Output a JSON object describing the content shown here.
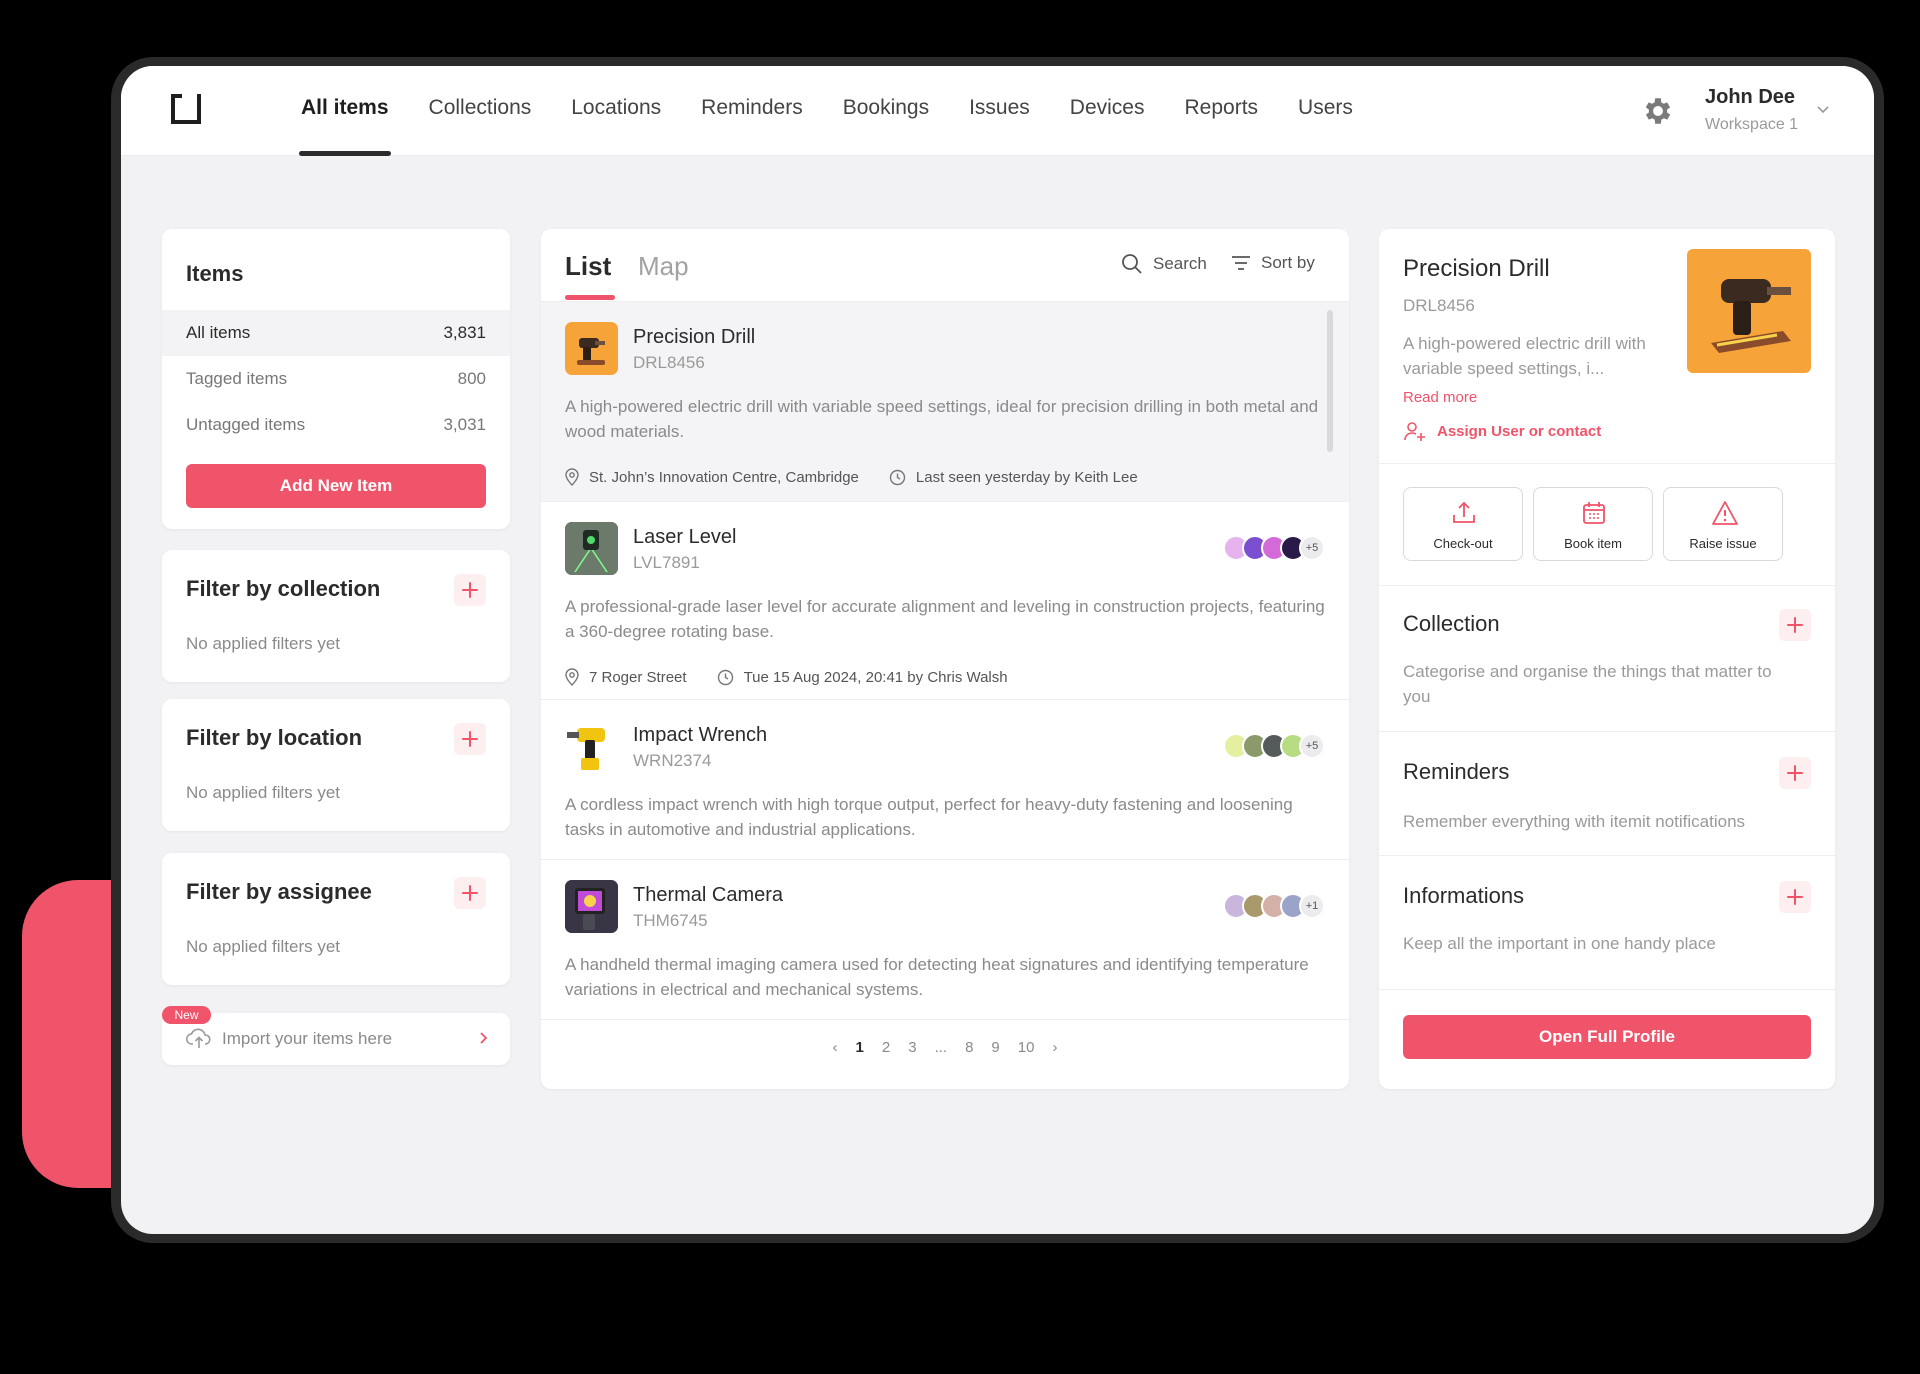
{
  "brand": {
    "accent": "#f0546a",
    "logo": "bracket-logo"
  },
  "nav": {
    "tabs": [
      {
        "label": "All items",
        "active": true
      },
      {
        "label": "Collections"
      },
      {
        "label": "Locations"
      },
      {
        "label": "Reminders"
      },
      {
        "label": "Bookings"
      },
      {
        "label": "Issues"
      },
      {
        "label": "Devices"
      },
      {
        "label": "Reports"
      },
      {
        "label": "Users"
      }
    ],
    "settings_icon": "gear-icon",
    "user": {
      "name": "John Dee",
      "workspace": "Workspace 1"
    }
  },
  "sidebar": {
    "items_title": "Items",
    "counts": [
      {
        "label": "All items",
        "value": "3,831",
        "active": true
      },
      {
        "label": "Tagged items",
        "value": "800"
      },
      {
        "label": "Untagged items",
        "value": "3,031"
      }
    ],
    "add_button": "Add New Item",
    "filters": [
      {
        "title": "Filter by collection",
        "empty": "No applied filters yet"
      },
      {
        "title": "Filter by location",
        "empty": "No applied filters yet"
      },
      {
        "title": "Filter by assignee",
        "empty": "No applied filters yet"
      }
    ],
    "import": {
      "badge": "New",
      "label": "Import your items here"
    }
  },
  "list": {
    "tabs": [
      "List",
      "Map"
    ],
    "search_label": "Search",
    "sort_label": "Sort by",
    "items": [
      {
        "name": "Precision Drill",
        "code": "DRL8456",
        "description": "A high-powered electric drill with variable speed settings, ideal for precision drilling in both metal and wood materials.",
        "location": "St. John’s Innovation Centre, Cambridge",
        "last_seen": "Last seen yesterday by Keith Lee"
      },
      {
        "name": "Laser Level",
        "code": "LVL7891",
        "description": "A professional-grade laser level for accurate alignment and leveling in construction projects, featuring a 360-degree rotating base.",
        "location": "7 Roger Street",
        "last_seen": "Tue 15 Aug 2024, 20:41 by Chris Walsh",
        "avatar_more": "+5"
      },
      {
        "name": "Impact Wrench",
        "code": "WRN2374",
        "description": "A cordless impact wrench with high torque output, perfect for heavy-duty fastening and loosening tasks in automotive and industrial applications.",
        "avatar_more": "+5"
      },
      {
        "name": "Thermal Camera",
        "code": "THM6745",
        "description": "A handheld thermal imaging camera used for detecting heat signatures and identifying temperature variations in electrical and mechanical systems.",
        "avatar_more": "+1"
      }
    ],
    "pagination": {
      "prev": "‹",
      "pages": [
        "1",
        "2",
        "3",
        "...",
        "8",
        "9",
        "10"
      ],
      "current": "1",
      "next": "›"
    }
  },
  "detail": {
    "title": "Precision Drill",
    "code": "DRL8456",
    "description": "A high-powered electric drill with variable speed settings, i...",
    "read_more": "Read more",
    "assign": "Assign User or contact",
    "actions": [
      {
        "label": "Check-out",
        "icon": "upload-icon"
      },
      {
        "label": "Book item",
        "icon": "calendar-icon"
      },
      {
        "label": "Raise issue",
        "icon": "warning-icon"
      }
    ],
    "sections": [
      {
        "title": "Collection",
        "desc": "Categorise and organise the things that matter to you"
      },
      {
        "title": "Reminders",
        "desc": "Remember everything with itemit notifications"
      },
      {
        "title": "Informations",
        "desc": "Keep all the important in one handy place"
      }
    ],
    "open_button": "Open Full Profile"
  }
}
